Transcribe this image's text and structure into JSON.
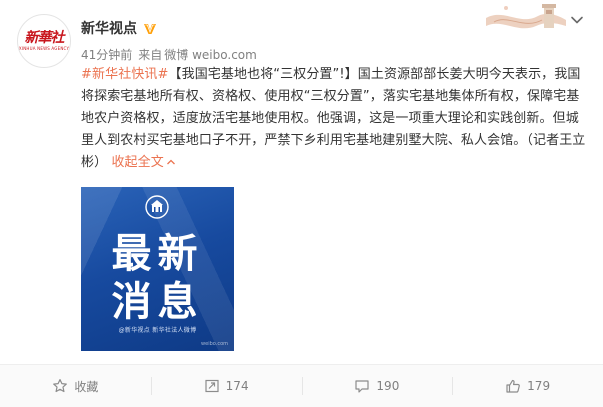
{
  "post": {
    "avatar": {
      "logo_text": "新華社",
      "logo_subtext": "XINHUA NEWS AGENCY"
    },
    "username": "新华视点",
    "verified_icon": "verified-v-icon",
    "time": "41分钟前",
    "source_prefix": "来自",
    "source": "微博 weibo.com",
    "text": {
      "hashtag": "#新华社快讯#",
      "body": "【我国宅基地也将“三权分置”!】国土资源部部长姜大明今天表示，我国将探索宅基地所有权、资格权、使用权“三权分置”，落实宅基地集体所有权，保障宅基地农户资格权，适度放活宅基地使用权。他强调，这是一项重大理论和实践创新。但城里人到农村买宅基地口子不开，严禁下乡利用宅基地建别墅大院、私人会馆。（记者王立彬）",
      "collapse_label": "收起全文"
    },
    "image": {
      "line1": "最新",
      "line2": "消息",
      "caption": "@新华视点  新华社法人微博",
      "watermark": "weibo.com"
    }
  },
  "footer": {
    "favorite_label": "收藏",
    "repost_count": "174",
    "comment_count": "190",
    "like_count": "179"
  },
  "colors": {
    "link": "#eb7350",
    "text": "#333333",
    "meta": "#808080",
    "image_blue": "#174a9f",
    "verified": "#ffa00a"
  }
}
